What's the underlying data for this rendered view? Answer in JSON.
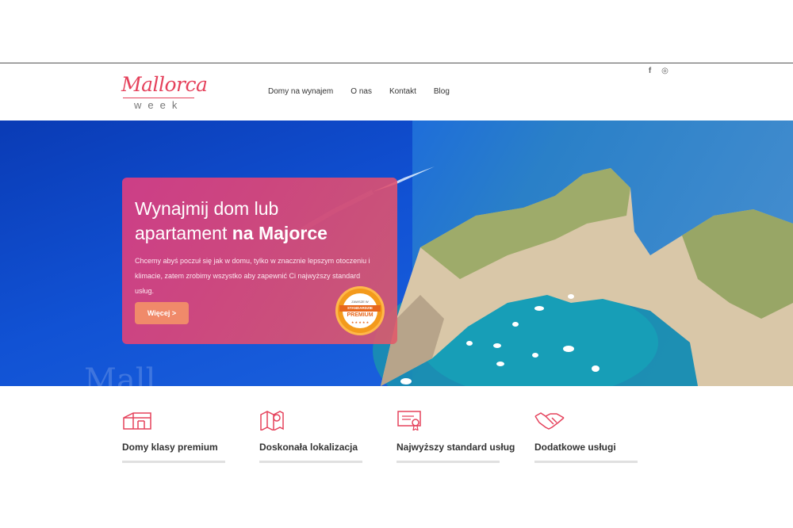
{
  "brand": {
    "logo_script": "Mallorca",
    "logo_sub": "week",
    "accent": "#e5425c"
  },
  "nav": {
    "items": [
      "Domy na wynajem",
      "O nas",
      "Kontakt",
      "Blog"
    ]
  },
  "social": {
    "icons": [
      "facebook-icon",
      "instagram-icon"
    ],
    "facebook_glyph": "f",
    "instagram_glyph": "◎"
  },
  "hero": {
    "title_plain": "Wynajmij dom lub apartament ",
    "title_bold": "na Majorce",
    "description": "Chcemy abyś poczuł się jak w domu, tylko w znacznie lepszym otoczeniu i klimacie, zatem zrobimy wszystko aby zapewnić Ci najwyższy standard usług.",
    "button_label": "Więcej >",
    "ghost_text": "Mall",
    "badge": {
      "line1": "ZAWSZE W",
      "line2": "STANDARDZIE",
      "line3": "PREMIUM",
      "line4": "★ ★ ★ ★ ★"
    }
  },
  "features": [
    {
      "icon": "house-icon",
      "title": "Domy klasy premium"
    },
    {
      "icon": "map-pin-icon",
      "title": "Doskonała lokalizacja"
    },
    {
      "icon": "certificate-icon",
      "title": "Najwyższy standard usług"
    },
    {
      "icon": "handshake-icon",
      "title": "Dodatkowe usługi"
    }
  ]
}
